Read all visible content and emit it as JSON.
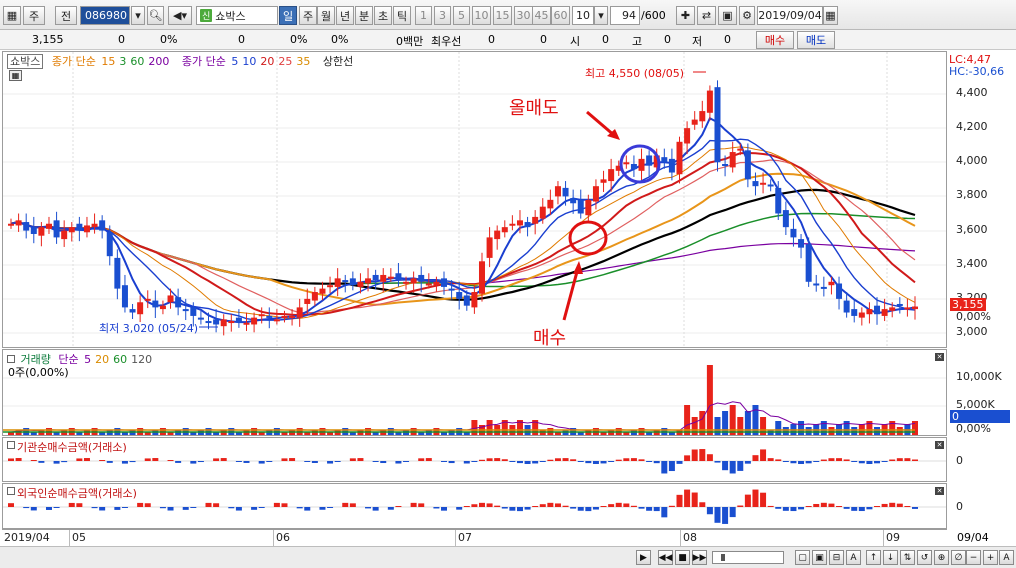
{
  "toolbar": {
    "ticker_chip": "주",
    "prev_label": "전",
    "code": "086980",
    "new_badge": "신",
    "stock_name": "쇼박스",
    "periods": [
      "일",
      "주",
      "월",
      "년",
      "분",
      "초",
      "틱"
    ],
    "active_period": "일",
    "intervals": [
      "1",
      "3",
      "5",
      "10",
      "15",
      "30",
      "45",
      "60"
    ],
    "interval_value": "10",
    "count": "94",
    "count_total": "/600",
    "date": "2019/09/04"
  },
  "inforow": {
    "price": "3,155",
    "change": "0",
    "change_pct": "0%",
    "v1": "0",
    "v1_pct": "0%",
    "v2_pct": "0%",
    "vol_label": "0백만",
    "best_label": "최우선",
    "best_v1": "0",
    "best_v2": "0",
    "open_label": "시",
    "open_v": "0",
    "high_label": "고",
    "high_v": "0",
    "low_label": "저",
    "low_v": "0",
    "buy_label": "매수",
    "sell_label": "매도"
  },
  "price_panel": {
    "name_tag": "쇼박스",
    "ma_close_label": "종가 단순",
    "ma_close_periods": [
      "15",
      "3",
      "60",
      "200"
    ],
    "ma_close_colors": [
      "#e07b00",
      "#1a8f2a",
      "#1a8f2a",
      "#7a00a0"
    ],
    "ma_simple_label": "종가 단순",
    "ma_simple_periods": [
      "5",
      "10",
      "20",
      "25",
      "35"
    ],
    "ma_simple_colors": [
      "#1a3fd0",
      "#1a3fd0",
      "#d01a1a",
      "#e04040",
      "#d98b00"
    ],
    "limit_label": "상한선",
    "lc_label": "LC:4,47",
    "hc_label": "HC:-30,66",
    "axis_ticks": [
      "4,400",
      "4,200",
      "4,000",
      "3,800",
      "3,600",
      "3,400",
      "3,200",
      "3,000"
    ],
    "current_price_box": "3,155",
    "current_pct": "0,00%",
    "high_annotation": "최고 4,550 (08/05)",
    "low_annotation": "최저 3,020 (05/24)",
    "sell_annotation": "올매도",
    "buy_annotation": "매수"
  },
  "volume_panel": {
    "title": "거래량",
    "ma_label": "단순",
    "ma_periods": [
      "5",
      "20",
      "60",
      "120"
    ],
    "ma_colors": [
      "#7a00a0",
      "#d98b00",
      "#1a8f2a",
      "#555555"
    ],
    "sub_label": "0주(0,00%)",
    "axis_ticks": [
      "10,000K",
      "5,000K"
    ],
    "current_box": "0",
    "current_pct": "0,00%"
  },
  "inst_panel": {
    "title": "기관순매수금액(거래소)",
    "axis_zero": "0"
  },
  "foreign_panel": {
    "title": "외국인순매수금액(거래소)",
    "axis_zero": "0"
  },
  "date_axis": {
    "labels": [
      "2019/04",
      "05",
      "06",
      "07",
      "08",
      "09"
    ],
    "right_label": "09/04"
  },
  "colors": {
    "up": "#e8231a",
    "down": "#1a4fd0",
    "annotation_red": "#e01010",
    "circle_blue": "#3a3ad8"
  }
}
